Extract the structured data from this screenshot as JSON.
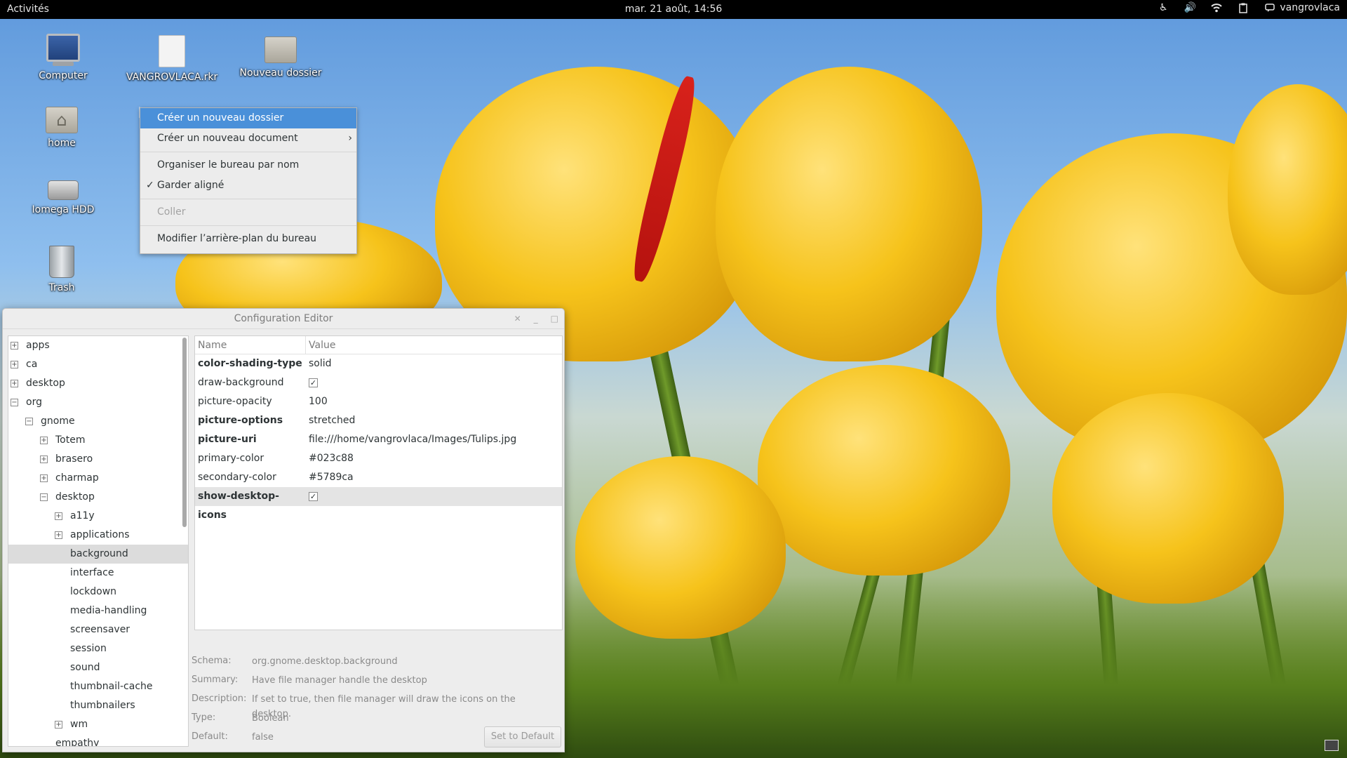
{
  "topbar": {
    "activities": "Activités",
    "clock": "mar. 21 août, 14:56",
    "user": "vangrovlaca"
  },
  "desktop_icons": [
    {
      "label": "Computer",
      "icon": "computer-icon"
    },
    {
      "label": "VANGROVLACA.rkr",
      "icon": "document-icon"
    },
    {
      "label": "Nouveau dossier",
      "icon": "folder-icon"
    },
    {
      "label": "home",
      "icon": "home-folder-icon"
    },
    {
      "label": "Iomega HDD",
      "icon": "hard-drive-icon"
    },
    {
      "label": "Trash",
      "icon": "trash-icon"
    }
  ],
  "context_menu": {
    "items": [
      {
        "label": "Créer un nouveau dossier",
        "state": "highlighted"
      },
      {
        "label": "Créer un nouveau document",
        "submenu": true
      },
      {
        "label": "Organiser le bureau par nom"
      },
      {
        "label": "Garder aligné",
        "checked": true
      },
      {
        "label": "Coller",
        "state": "disabled"
      },
      {
        "label": "Modifier l’arrière-plan du bureau"
      }
    ]
  },
  "config_editor": {
    "title": "Configuration Editor",
    "tree": [
      {
        "label": "apps",
        "expander": "plus"
      },
      {
        "label": "ca",
        "expander": "plus"
      },
      {
        "label": "desktop",
        "expander": "plus"
      },
      {
        "label": "org",
        "expander": "minus"
      },
      {
        "label": "gnome",
        "expander": "minus"
      },
      {
        "label": "Totem",
        "expander": "plus"
      },
      {
        "label": "brasero",
        "expander": "plus"
      },
      {
        "label": "charmap",
        "expander": "plus"
      },
      {
        "label": "desktop",
        "expander": "minus"
      },
      {
        "label": "a11y",
        "expander": "plus"
      },
      {
        "label": "applications",
        "expander": "plus"
      },
      {
        "label": "background",
        "selected": true
      },
      {
        "label": "interface"
      },
      {
        "label": "lockdown"
      },
      {
        "label": "media-handling"
      },
      {
        "label": "screensaver"
      },
      {
        "label": "session"
      },
      {
        "label": "sound"
      },
      {
        "label": "thumbnail-cache"
      },
      {
        "label": "thumbnailers"
      },
      {
        "label": "wm",
        "expander": "plus"
      },
      {
        "label": "empathy"
      }
    ],
    "columns": {
      "name": "Name",
      "value": "Value"
    },
    "rows": [
      {
        "name": "color-shading-type",
        "value": "solid",
        "bold": true
      },
      {
        "name": "draw-background",
        "value": "",
        "checkbox": true
      },
      {
        "name": "picture-opacity",
        "value": "100"
      },
      {
        "name": "picture-options",
        "value": "stretched",
        "bold": true
      },
      {
        "name": "picture-uri",
        "value": "file:///home/vangrovlaca/Images/Tulips.jpg",
        "bold": true
      },
      {
        "name": "primary-color",
        "value": "#023c88"
      },
      {
        "name": "secondary-color",
        "value": "#5789ca"
      },
      {
        "name": "show-desktop-icons",
        "value": "",
        "checkbox": true,
        "bold": true,
        "selected": true
      }
    ],
    "details": {
      "schema_label": "Schema:",
      "schema": "org.gnome.desktop.background",
      "summary_label": "Summary:",
      "summary": "Have file manager handle the desktop",
      "description_label": "Description:",
      "description": "If set to true, then file manager will draw the icons on the desktop.",
      "type_label": "Type:",
      "type": "Boolean",
      "default_label": "Default:",
      "default": "false"
    },
    "set_default_button": "Set to Default"
  },
  "colors": {
    "topbar_bg": "#000000",
    "menu_highlight": "#4a90d9"
  }
}
